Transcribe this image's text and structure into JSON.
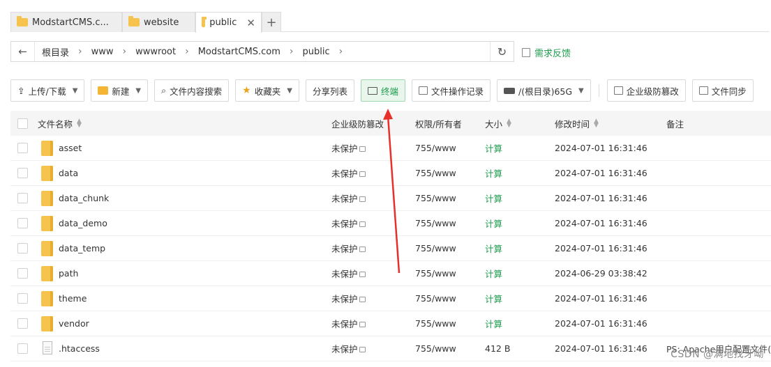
{
  "tabs": [
    {
      "label": "ModstartCMS.c...",
      "active": false
    },
    {
      "label": "website",
      "active": false
    },
    {
      "label": "public",
      "active": true
    }
  ],
  "breadcrumb": [
    "根目录",
    "www",
    "wwwroot",
    "ModstartCMS.com",
    "public"
  ],
  "feedback_label": "需求反馈",
  "toolbar": {
    "upload": "上传/下载",
    "new": "新建",
    "search": "文件内容搜索",
    "favorites": "收藏夹",
    "share": "分享列表",
    "terminal": "终端",
    "oplog": "文件操作记录",
    "disk": "/(根目录)65G",
    "tamper": "企业级防篡改",
    "sync": "文件同步"
  },
  "table": {
    "headers": {
      "name": "文件名称",
      "protect": "企业级防篡改",
      "perm": "权限/所有者",
      "size": "大小",
      "mtime": "修改时间",
      "note": "备注"
    },
    "rows": [
      {
        "type": "folder",
        "name": "asset",
        "protect": "未保护",
        "perm": "755/www",
        "size": "计算",
        "mtime": "2024-07-01 16:31:46",
        "note": ""
      },
      {
        "type": "folder",
        "name": "data",
        "protect": "未保护",
        "perm": "755/www",
        "size": "计算",
        "mtime": "2024-07-01 16:31:46",
        "note": ""
      },
      {
        "type": "folder",
        "name": "data_chunk",
        "protect": "未保护",
        "perm": "755/www",
        "size": "计算",
        "mtime": "2024-07-01 16:31:46",
        "note": ""
      },
      {
        "type": "folder",
        "name": "data_demo",
        "protect": "未保护",
        "perm": "755/www",
        "size": "计算",
        "mtime": "2024-07-01 16:31:46",
        "note": ""
      },
      {
        "type": "folder",
        "name": "data_temp",
        "protect": "未保护",
        "perm": "755/www",
        "size": "计算",
        "mtime": "2024-07-01 16:31:46",
        "note": ""
      },
      {
        "type": "folder",
        "name": "path",
        "protect": "未保护",
        "perm": "755/www",
        "size": "计算",
        "mtime": "2024-06-29 03:38:42",
        "note": ""
      },
      {
        "type": "folder",
        "name": "theme",
        "protect": "未保护",
        "perm": "755/www",
        "size": "计算",
        "mtime": "2024-07-01 16:31:46",
        "note": ""
      },
      {
        "type": "folder",
        "name": "vendor",
        "protect": "未保护",
        "perm": "755/www",
        "size": "计算",
        "mtime": "2024-07-01 16:31:46",
        "note": ""
      },
      {
        "type": "file",
        "name": ".htaccess",
        "protect": "未保护",
        "perm": "755/www",
        "size": "412 B",
        "mtime": "2024-07-01 16:31:46",
        "note": "PS: Apache用户配置文件(伪"
      }
    ]
  },
  "watermark": "CSDN @满地找牙呦",
  "colors": {
    "accent_green": "#1f9c4e",
    "folder_yellow": "#f6c34e",
    "arrow_red": "#e8302a"
  }
}
